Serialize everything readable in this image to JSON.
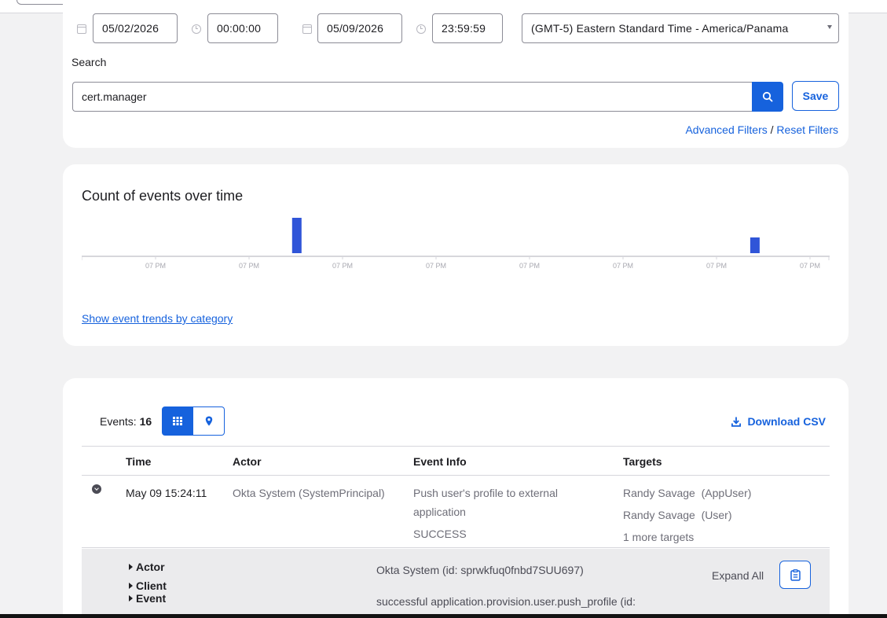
{
  "filters": {
    "start_date": "05/02/2026",
    "start_time": "00:00:00",
    "end_date": "05/09/2026",
    "end_time": "23:59:59",
    "timezone": "(GMT-5) Eastern Standard Time - America/Panama",
    "search_label": "Search",
    "search_value": "cert.manager",
    "save_label": "Save",
    "advanced_filters": "Advanced Filters",
    "separator": "/",
    "reset_filters": "Reset Filters"
  },
  "chart": {
    "title": "Count of events over time",
    "trend_link": "Show event trends by category"
  },
  "chart_data": {
    "type": "bar",
    "title": "Count of events over time",
    "xlabel": "",
    "ylabel": "",
    "categories": [
      "07 PM",
      "07 PM",
      "07 PM",
      "07 PM",
      "07 PM",
      "07 PM",
      "07 PM",
      "07 PM"
    ],
    "bars": [
      {
        "slot": 2.7,
        "value": 45
      },
      {
        "slot": 7.6,
        "value": 20
      }
    ],
    "grid": false,
    "bar_color": "#3055d8"
  },
  "events": {
    "label": "Events:",
    "count": "16",
    "download_csv": "Download CSV",
    "columns": [
      "Time",
      "Actor",
      "Event Info",
      "Targets"
    ],
    "rows": [
      {
        "time": "May 09 15:24:11",
        "actor_name": "Okta System",
        "actor_type": "(SystemPrincipal)",
        "event_line1": "Push user's profile to external",
        "event_line2": "application",
        "outcome": "SUCCESS",
        "target1_name": "Randy Savage",
        "target1_type": "(AppUser)",
        "target2_name": "Randy Savage",
        "target2_type": "(User)",
        "more_targets": "1 more targets"
      }
    ],
    "details": {
      "actor": "Actor",
      "client": "Client",
      "event": "Event",
      "actor_value": "Okta System (id: sprwkfuq0fnbd7SUU697)",
      "event_value": "successful application.provision.user.push_profile  (id:",
      "expand_all": "Expand All"
    }
  },
  "colors": {
    "accent": "#1662dd",
    "bar": "#3055d8"
  }
}
